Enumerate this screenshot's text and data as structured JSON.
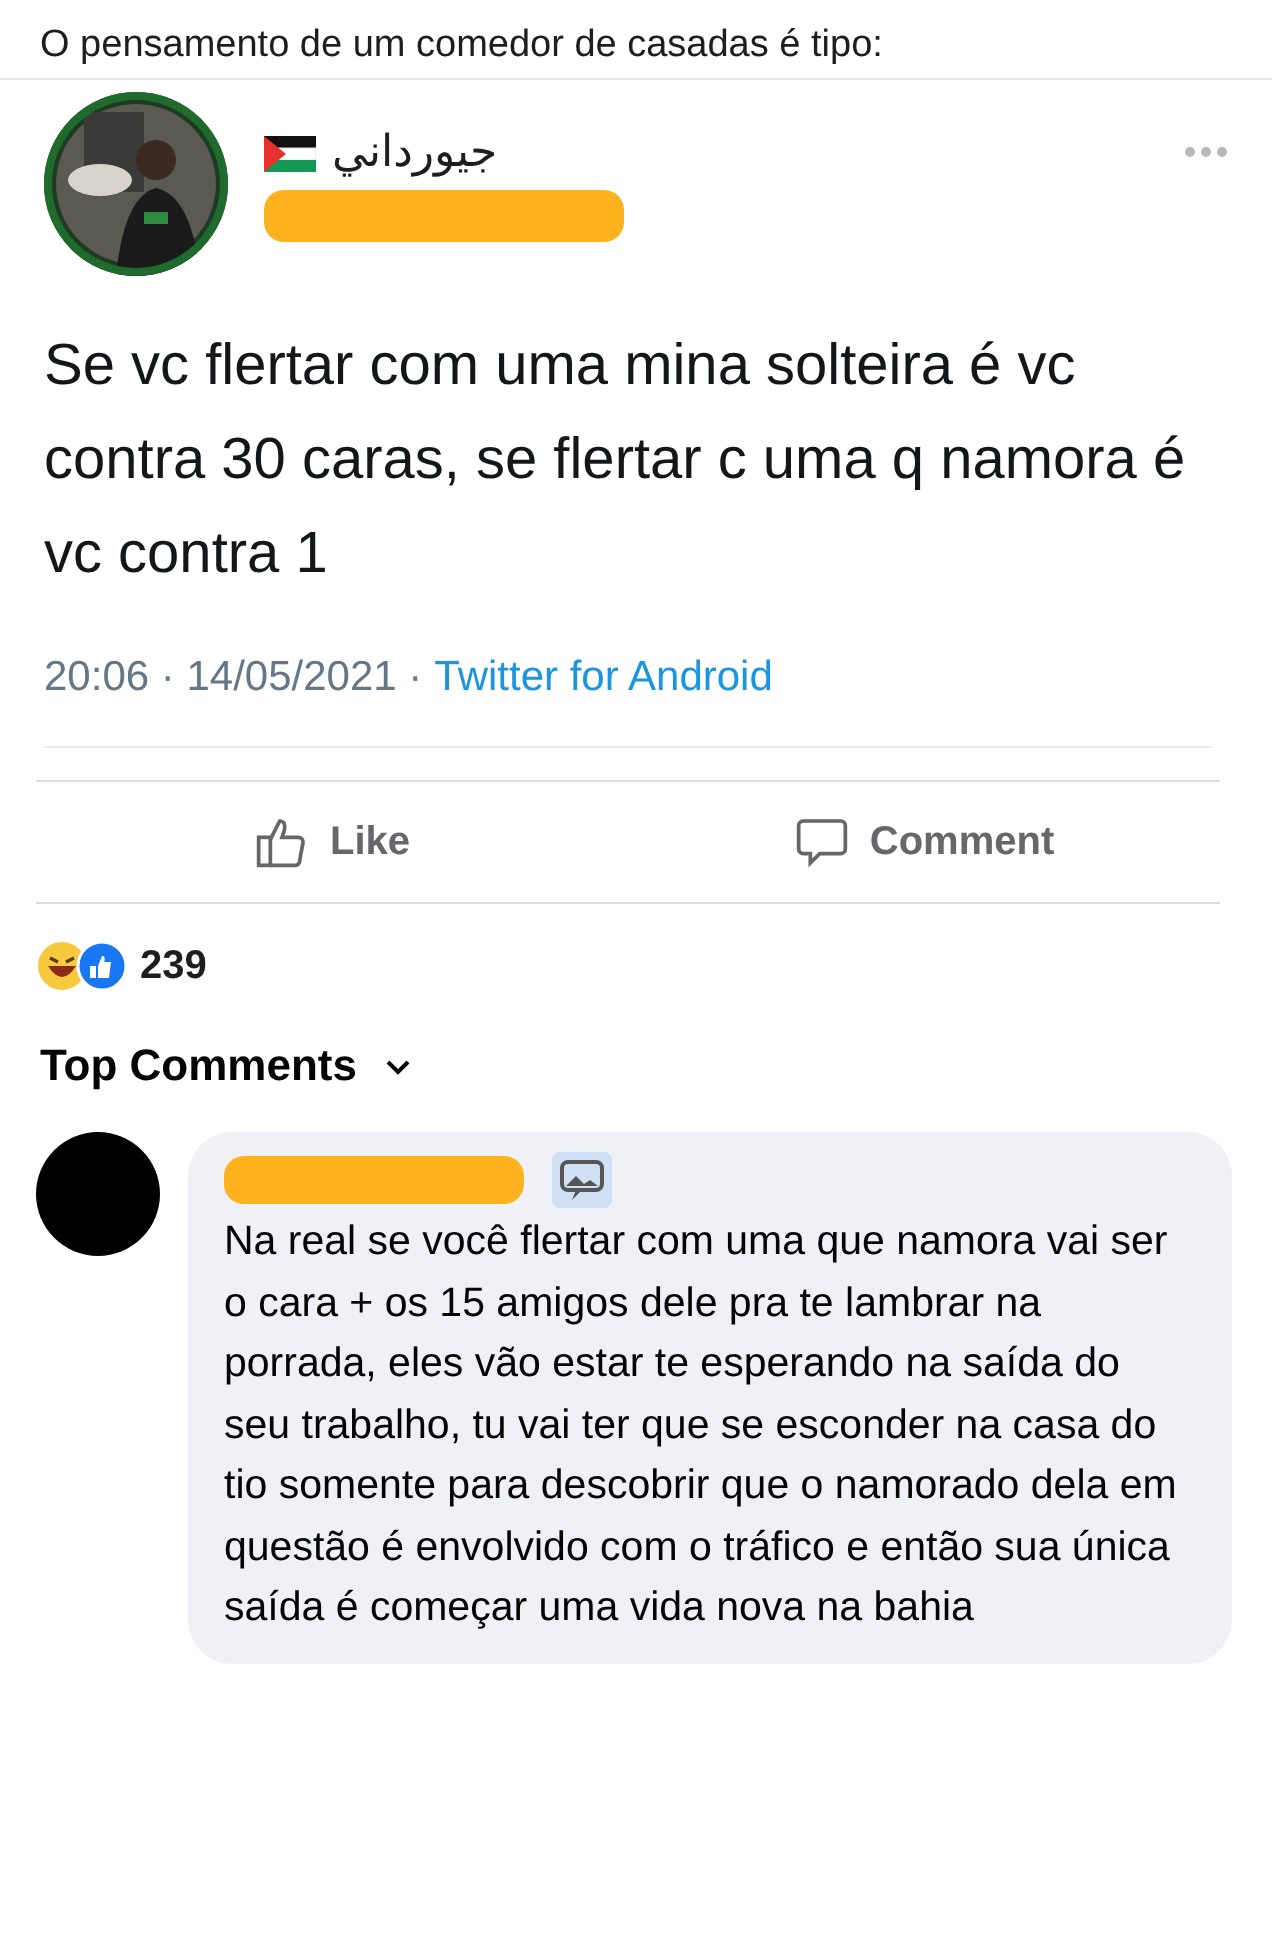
{
  "caption": "O pensamento de um comedor de casadas é tipo:",
  "tweet": {
    "author": {
      "name": "جيورداني"
    },
    "text": "Se vc flertar com uma mina solteira é vc contra 30 caras, se flertar c uma q namora é vc contra 1",
    "timestamp": "20:06 · 14/05/2021 ·",
    "source": "Twitter for Android"
  },
  "actions": [
    {
      "kind": "like",
      "label": "Like"
    },
    {
      "kind": "comment",
      "label": "Comment"
    }
  ],
  "reactions": {
    "count": "239"
  },
  "comments_header": {
    "label": "Top Comments"
  },
  "comments": [
    {
      "text": "Na real se você flertar com uma que namora vai ser o cara + os 15 amigos dele pra te lambrar na porrada, eles vão estar te esperando na saída do seu trabalho, tu vai ter que se esconder na casa do tio somente para descobrir que o namorado dela em questão é envolvido com o tráfico e então sua única saída é começar uma vida nova na bahia"
    }
  ]
}
